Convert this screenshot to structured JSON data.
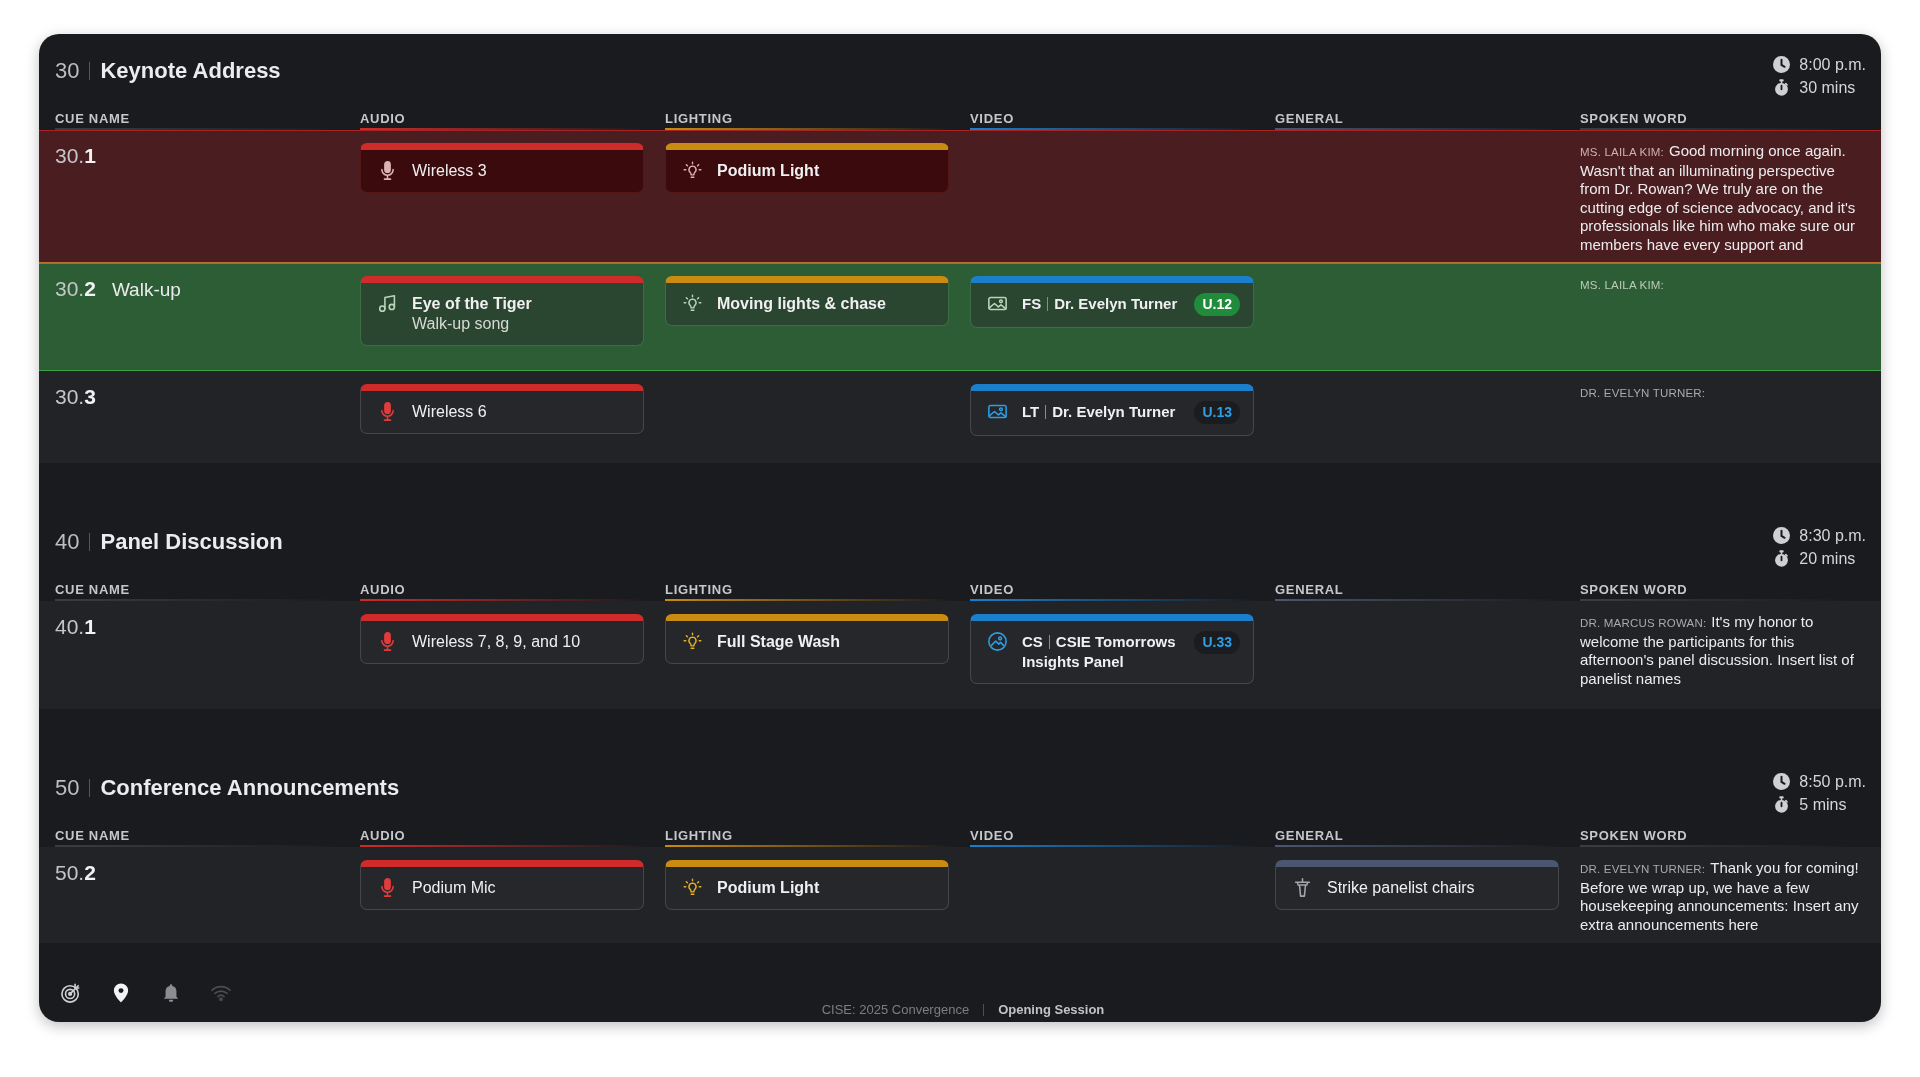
{
  "sections": [
    {
      "number": "30",
      "title": "Keynote Address",
      "start_time": "8:00 p.m.",
      "duration": "30 mins",
      "columns": [
        {
          "kind": "cue",
          "label": "CUE NAME"
        },
        {
          "kind": "audio",
          "label": "AUDIO"
        },
        {
          "kind": "lighting",
          "label": "LIGHTING"
        },
        {
          "kind": "video",
          "label": "VIDEO"
        },
        {
          "kind": "general",
          "label": "GENERAL"
        },
        {
          "kind": "spoken_word",
          "label": "SPOKEN WORD"
        }
      ],
      "cues": [
        {
          "cue": "30.**1**",
          "live": true,
          "standby": false,
          "audio": {
            "kind": "mic",
            "title": "Wireless 3"
          },
          "lighting": {
            "kind": "bulb",
            "title": "Podium Light"
          },
          "spoken_word": {
            "speaker": "MS. LAILA KIM:",
            "text": "Good morning once again. Wasn't that an illuminating perspective from Dr. Rowan? We truly are on the cutting edge of science advocacy, and it's professionals like him who make sure our members have every support and"
          }
        },
        {
          "cue": "30.**2**",
          "name": "Walk-up",
          "live": false,
          "standby": true,
          "audio": {
            "kind": "music",
            "title": "Eye of the Tiger",
            "subtitle": "Walk-up song"
          },
          "lighting": {
            "kind": "bulb",
            "title": "Moving lights & chase"
          },
          "video": {
            "kind": "image",
            "code": "FS",
            "title": "Dr. Evelyn Turner",
            "badge": "U.12"
          },
          "spoken_word": {
            "speaker": "MS. LAILA KIM:"
          }
        },
        {
          "cue": "30.**3**",
          "live": false,
          "standby": false,
          "audio": {
            "kind": "mic",
            "title": "Wireless 6"
          },
          "video": {
            "kind": "image",
            "code": "LT",
            "title": "Dr. Evelyn Turner",
            "badge": "U.13"
          },
          "spoken_word": {
            "speaker": "DR. EVELYN TURNER:"
          }
        }
      ]
    },
    {
      "number": "40",
      "title": "Panel Discussion",
      "start_time": "8:30 p.m.",
      "duration": "20 mins",
      "columns": [
        {
          "kind": "cue",
          "label": "CUE NAME"
        },
        {
          "kind": "audio",
          "label": "AUDIO"
        },
        {
          "kind": "lighting",
          "label": "LIGHTING"
        },
        {
          "kind": "video",
          "label": "VIDEO"
        },
        {
          "kind": "general",
          "label": "GENERAL"
        },
        {
          "kind": "spoken_word",
          "label": "SPOKEN WORD"
        }
      ],
      "cues": [
        {
          "cue": "40.**1**",
          "live": false,
          "standby": false,
          "audio": {
            "kind": "mic",
            "title": "Wireless 7, 8, 9, and 10"
          },
          "lighting": {
            "kind": "bulb",
            "title": "Full Stage Wash"
          },
          "video": {
            "kind": "image_circle",
            "code": "CS",
            "title": "CSIE Tomorrows Insights Panel",
            "badge": "U.33"
          },
          "spoken_word": {
            "speaker": "DR. MARCUS ROWAN:",
            "text": "It's my honor to welcome the participants for this afternoon's panel discussion. Insert list of panelist names"
          }
        }
      ]
    },
    {
      "number": "50",
      "title": "Conference Announcements",
      "start_time": "8:50 p.m.",
      "duration": "5 mins",
      "columns": [
        {
          "kind": "cue",
          "label": "CUE NAME"
        },
        {
          "kind": "audio",
          "label": "AUDIO"
        },
        {
          "kind": "lighting",
          "label": "LIGHTING"
        },
        {
          "kind": "video",
          "label": "VIDEO"
        },
        {
          "kind": "general",
          "label": "GENERAL"
        },
        {
          "kind": "spoken_word",
          "label": "SPOKEN WORD"
        }
      ],
      "cues": [
        {
          "cue": "50.**2**",
          "live": false,
          "standby": false,
          "audio": {
            "kind": "mic",
            "title": "Podium Mic"
          },
          "lighting": {
            "kind": "bulb",
            "title": "Podium Light"
          },
          "general": {
            "kind": "podium",
            "title": "Strike panelist chairs"
          },
          "spoken_word": {
            "speaker": "DR. EVELYN TURNER:",
            "text": "Thank you for coming! Before we wrap up, we have a few housekeeping announcements: Insert any extra announcements here"
          }
        }
      ]
    }
  ],
  "footer": {
    "indicators": [
      {
        "kind": "target"
      },
      {
        "kind": "location"
      },
      {
        "kind": "bell"
      },
      {
        "kind": "wifi"
      }
    ],
    "event": "CISE: 2025 Convergence",
    "session": "Opening Session"
  }
}
